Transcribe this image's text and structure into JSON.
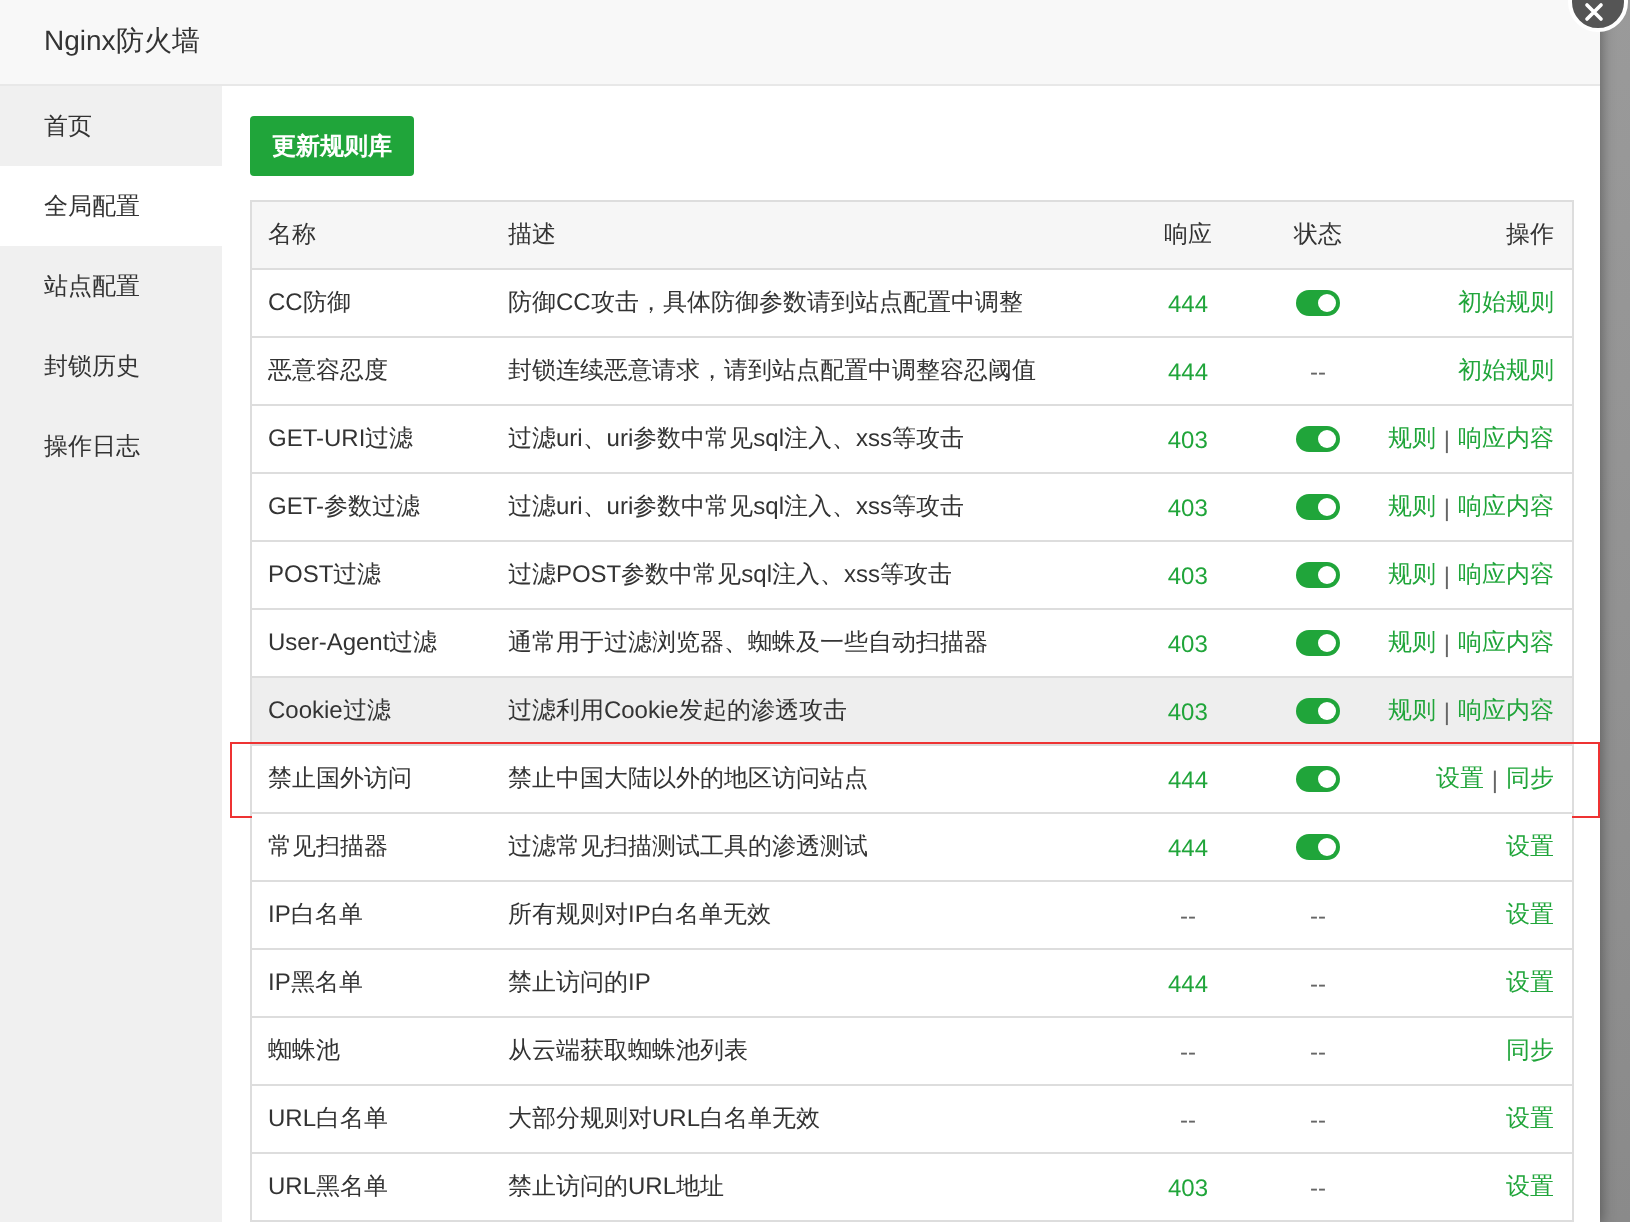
{
  "window": {
    "title": "Nginx防火墙"
  },
  "sidebar": {
    "items": [
      {
        "label": "首页",
        "selected": false
      },
      {
        "label": "全局配置",
        "selected": true
      },
      {
        "label": "站点配置",
        "selected": false
      },
      {
        "label": "封锁历史",
        "selected": false
      },
      {
        "label": "操作日志",
        "selected": false
      }
    ]
  },
  "update_button": "更新规则库",
  "table": {
    "columns": [
      "名称",
      "描述",
      "响应",
      "状态",
      "操作"
    ],
    "rows": [
      {
        "name": "CC防御",
        "description": "防御CC攻击，具体防御参数请到站点配置中调整",
        "response": "444",
        "status": {
          "kind": "toggle",
          "on": true
        },
        "actions": [
          {
            "kind": "link",
            "text": "初始规则"
          }
        ],
        "hovered": false,
        "highlighted": false
      },
      {
        "name": "恶意容忍度",
        "description": "封锁连续恶意请求，请到站点配置中调整容忍阈值",
        "response": "444",
        "status": {
          "kind": "text",
          "text": "--"
        },
        "actions": [
          {
            "kind": "link",
            "text": "初始规则"
          }
        ],
        "hovered": false,
        "highlighted": false
      },
      {
        "name": "GET-URI过滤",
        "description": "过滤uri、uri参数中常见sql注入、xss等攻击",
        "response": "403",
        "status": {
          "kind": "toggle",
          "on": true
        },
        "actions": [
          {
            "kind": "link",
            "text": "规则"
          },
          {
            "kind": "separator",
            "text": "|"
          },
          {
            "kind": "link",
            "text": "响应内容"
          }
        ],
        "hovered": false,
        "highlighted": false
      },
      {
        "name": "GET-参数过滤",
        "description": "过滤uri、uri参数中常见sql注入、xss等攻击",
        "response": "403",
        "status": {
          "kind": "toggle",
          "on": true
        },
        "actions": [
          {
            "kind": "link",
            "text": "规则"
          },
          {
            "kind": "separator",
            "text": "|"
          },
          {
            "kind": "link",
            "text": "响应内容"
          }
        ],
        "hovered": false,
        "highlighted": false
      },
      {
        "name": "POST过滤",
        "description": "过滤POST参数中常见sql注入、xss等攻击",
        "response": "403",
        "status": {
          "kind": "toggle",
          "on": true
        },
        "actions": [
          {
            "kind": "link",
            "text": "规则"
          },
          {
            "kind": "separator",
            "text": "|"
          },
          {
            "kind": "link",
            "text": "响应内容"
          }
        ],
        "hovered": false,
        "highlighted": false
      },
      {
        "name": "User-Agent过滤",
        "description": "通常用于过滤浏览器、蜘蛛及一些自动扫描器",
        "response": "403",
        "status": {
          "kind": "toggle",
          "on": true
        },
        "actions": [
          {
            "kind": "link",
            "text": "规则"
          },
          {
            "kind": "separator",
            "text": "|"
          },
          {
            "kind": "link",
            "text": "响应内容"
          }
        ],
        "hovered": false,
        "highlighted": false
      },
      {
        "name": "Cookie过滤",
        "description": "过滤利用Cookie发起的渗透攻击",
        "response": "403",
        "status": {
          "kind": "toggle",
          "on": true
        },
        "actions": [
          {
            "kind": "link",
            "text": "规则"
          },
          {
            "kind": "separator",
            "text": "|"
          },
          {
            "kind": "link",
            "text": "响应内容"
          }
        ],
        "hovered": true,
        "highlighted": false
      },
      {
        "name": "禁止国外访问",
        "description": "禁止中国大陆以外的地区访问站点",
        "response": "444",
        "status": {
          "kind": "toggle",
          "on": true
        },
        "actions": [
          {
            "kind": "link",
            "text": "设置"
          },
          {
            "kind": "separator",
            "text": "|"
          },
          {
            "kind": "link",
            "text": "同步"
          }
        ],
        "hovered": false,
        "highlighted": true
      },
      {
        "name": "常见扫描器",
        "description": "过滤常见扫描测试工具的渗透测试",
        "response": "444",
        "status": {
          "kind": "toggle",
          "on": true
        },
        "actions": [
          {
            "kind": "link",
            "text": "设置"
          }
        ],
        "hovered": false,
        "highlighted": false
      },
      {
        "name": "IP白名单",
        "description": "所有规则对IP白名单无效",
        "response": "--",
        "status": {
          "kind": "text",
          "text": "--"
        },
        "actions": [
          {
            "kind": "link",
            "text": "设置"
          }
        ],
        "hovered": false,
        "highlighted": false
      },
      {
        "name": "IP黑名单",
        "description": "禁止访问的IP",
        "response": "444",
        "status": {
          "kind": "text",
          "text": "--"
        },
        "actions": [
          {
            "kind": "link",
            "text": "设置"
          }
        ],
        "hovered": false,
        "highlighted": false
      },
      {
        "name": "蜘蛛池",
        "description": "从云端获取蜘蛛池列表",
        "response": "--",
        "status": {
          "kind": "text",
          "text": "--"
        },
        "actions": [
          {
            "kind": "link",
            "text": "同步"
          }
        ],
        "hovered": false,
        "highlighted": false
      },
      {
        "name": "URL白名单",
        "description": "大部分规则对URL白名单无效",
        "response": "--",
        "status": {
          "kind": "text",
          "text": "--"
        },
        "actions": [
          {
            "kind": "link",
            "text": "设置"
          }
        ],
        "hovered": false,
        "highlighted": false
      },
      {
        "name": "URL黑名单",
        "description": "禁止访问的URL地址",
        "response": "403",
        "status": {
          "kind": "text",
          "text": "--"
        },
        "actions": [
          {
            "kind": "link",
            "text": "设置"
          }
        ],
        "hovered": false,
        "highlighted": false
      }
    ]
  }
}
